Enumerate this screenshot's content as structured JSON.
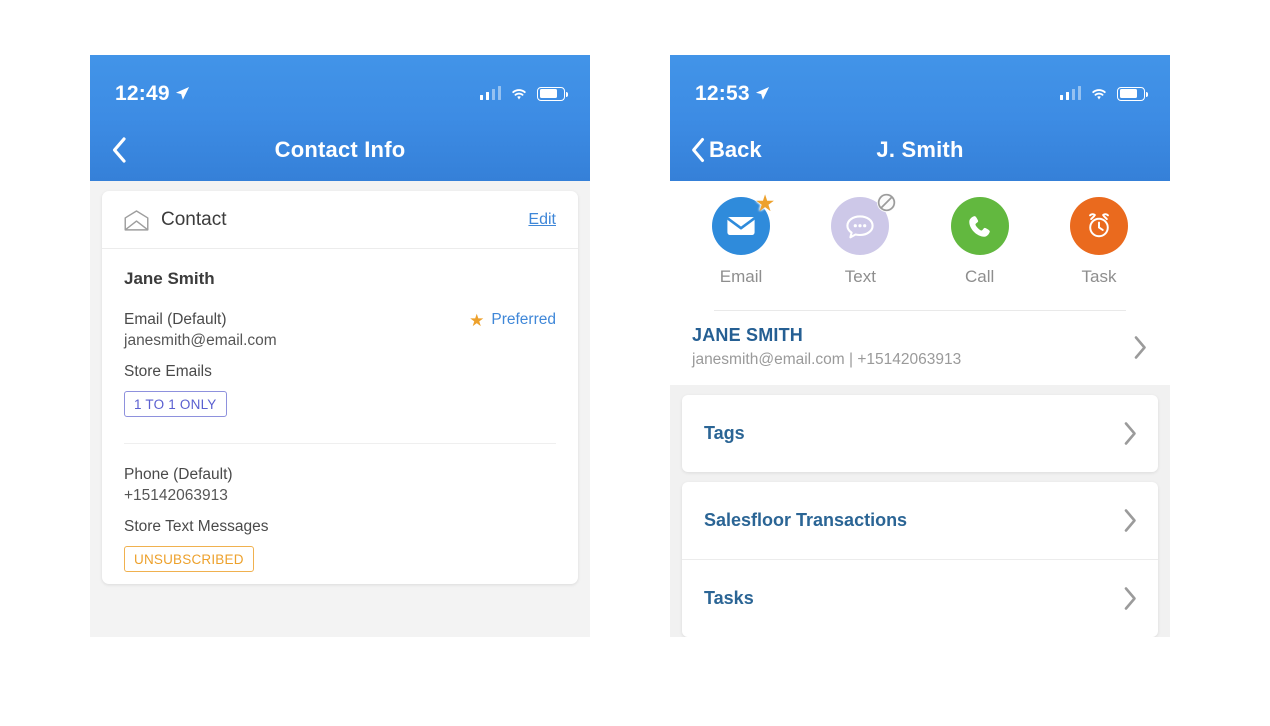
{
  "colors": {
    "header_blue_top": "#4294e8",
    "header_blue_bottom": "#3580d8",
    "link_blue": "#3f87d8",
    "list_label_blue": "#2b6595",
    "badge_blue": "#5a5fd0",
    "badge_orange": "#eda12c",
    "star_gold": "#eda12c",
    "email_blue": "#2f8bdb",
    "text_lavender": "#cdc8e8",
    "call_green": "#62b83f",
    "task_orange": "#ea6a1e",
    "page_bg": "#f1f1f1"
  },
  "left_phone": {
    "status_bar": {
      "time": "12:49",
      "location_icon": "location-arrow-icon",
      "signal_icon": "cellular-signal-icon",
      "signal_bars_filled": 2,
      "signal_bars_total": 4,
      "wifi_icon": "wifi-icon",
      "battery_icon": "battery-icon",
      "battery_level_pct": 78
    },
    "nav": {
      "back_icon": "chevron-left-icon",
      "back_label": "",
      "title": "Contact Info"
    },
    "card": {
      "header": {
        "icon": "envelope-open-icon",
        "title": "Contact",
        "edit_label": "Edit"
      },
      "person_name": "Jane Smith",
      "email_section": {
        "label": "Email (Default)",
        "value": "janesmith@email.com",
        "preferred_icon": "star-icon",
        "preferred_label": "Preferred",
        "sub_label": "Store Emails",
        "badge": "1 TO 1 ONLY"
      },
      "phone_section": {
        "label": "Phone (Default)",
        "value": "+15142063913",
        "sub_label": "Store Text Messages",
        "badge": "UNSUBSCRIBED"
      }
    }
  },
  "right_phone": {
    "status_bar": {
      "time": "12:53",
      "location_icon": "location-arrow-icon",
      "signal_icon": "cellular-signal-icon",
      "signal_bars_filled": 2,
      "signal_bars_total": 4,
      "wifi_icon": "wifi-icon",
      "battery_icon": "battery-icon",
      "battery_level_pct": 78
    },
    "nav": {
      "back_icon": "chevron-left-icon",
      "back_label": "Back",
      "title": "J. Smith"
    },
    "actions": [
      {
        "label": "Email",
        "icon": "envelope-icon",
        "badge_icon": "star-icon",
        "enabled": true
      },
      {
        "label": "Text",
        "icon": "chat-bubble-icon",
        "badge_icon": "blocked-icon",
        "enabled": false
      },
      {
        "label": "Call",
        "icon": "phone-handset-icon",
        "badge_icon": "",
        "enabled": true
      },
      {
        "label": "Task",
        "icon": "alarm-clock-icon",
        "badge_icon": "",
        "enabled": true
      }
    ],
    "contact_row": {
      "name": "JANE SMITH",
      "subtitle": "janesmith@email.com  |  +15142063913",
      "chevron_icon": "chevron-right-icon"
    },
    "sections": [
      {
        "items": [
          {
            "label": "Tags",
            "chevron_icon": "chevron-right-icon"
          }
        ]
      },
      {
        "items": [
          {
            "label": "Salesfloor Transactions",
            "chevron_icon": "chevron-right-icon"
          },
          {
            "label": "Tasks",
            "chevron_icon": "chevron-right-icon"
          }
        ]
      }
    ]
  }
}
